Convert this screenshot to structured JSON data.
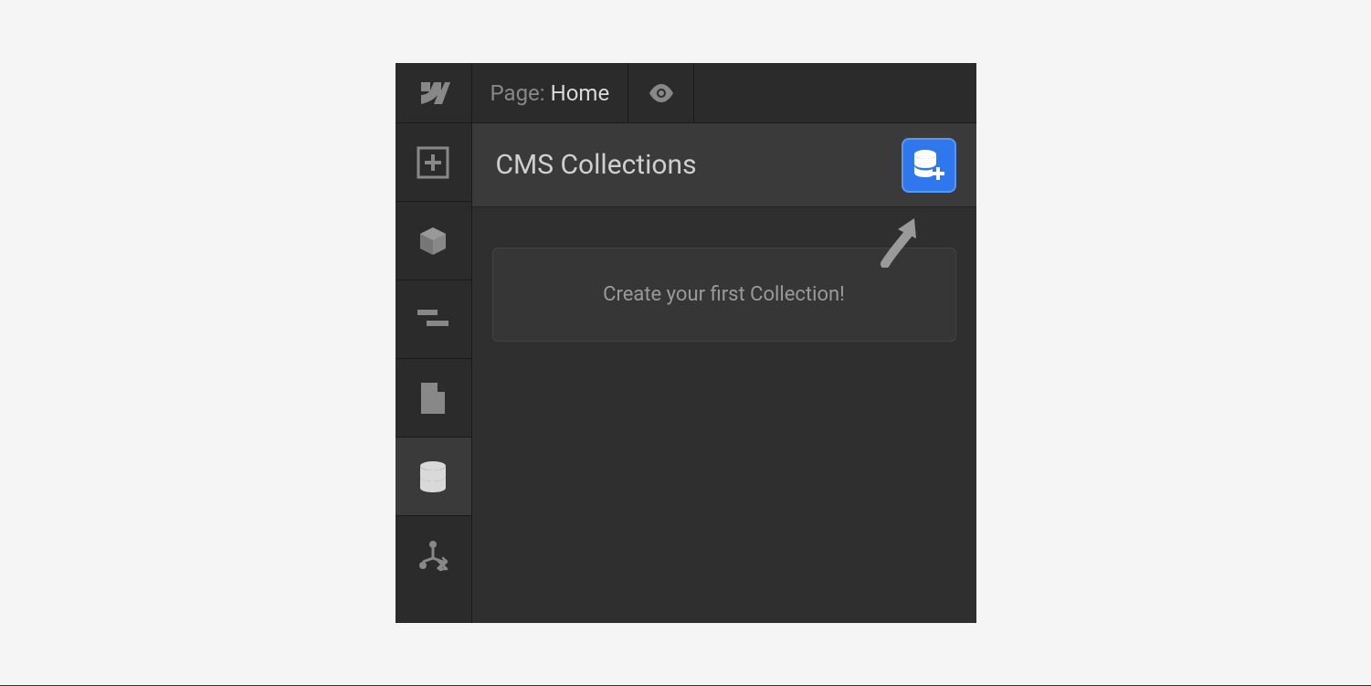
{
  "topbar": {
    "page_label": "Page:",
    "page_name": "Home"
  },
  "panel": {
    "title": "CMS Collections",
    "hint": "Create your first Collection!"
  },
  "sidebar": {
    "items": [
      {
        "name": "add",
        "active": false
      },
      {
        "name": "components",
        "active": false
      },
      {
        "name": "navigator",
        "active": false
      },
      {
        "name": "pages",
        "active": false
      },
      {
        "name": "cms",
        "active": true
      },
      {
        "name": "assets-tree",
        "active": false
      }
    ]
  }
}
